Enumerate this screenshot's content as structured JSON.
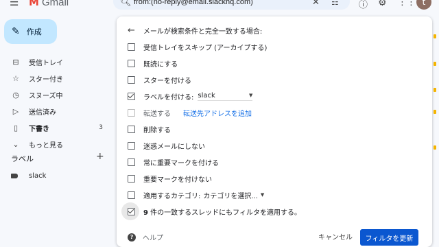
{
  "app": {
    "logo_text": "Gmail"
  },
  "search": {
    "query": "from:(no-reply@email.slackhq.com)"
  },
  "header": {
    "avatar_letter": "t"
  },
  "compose": {
    "label": "作成"
  },
  "nav": [
    {
      "icon": "inbox-icon",
      "label": "受信トレイ",
      "count": ""
    },
    {
      "icon": "star-icon",
      "label": "スター付き",
      "count": ""
    },
    {
      "icon": "clock-icon",
      "label": "スヌーズ中",
      "count": ""
    },
    {
      "icon": "send-icon",
      "label": "送信済み",
      "count": ""
    },
    {
      "icon": "draft-icon",
      "label": "下書き",
      "count": "3"
    },
    {
      "icon": "chevron-down-icon",
      "label": "もっと見る",
      "count": ""
    }
  ],
  "labels": {
    "heading": "ラベル",
    "items": [
      {
        "name": "slack"
      }
    ]
  },
  "filter": {
    "header": "メールが検索条件と完全一致する場合:",
    "options": [
      {
        "label": "受信トレイをスキップ (アーカイブする)"
      },
      {
        "label": "既読にする"
      },
      {
        "label": "スターを付ける"
      },
      {
        "label": "ラベルを付ける:",
        "value": "slack"
      },
      {
        "label": "転送する",
        "link": "転送先アドレスを追加"
      },
      {
        "label": "削除する"
      },
      {
        "label": "迷惑メールにしない"
      },
      {
        "label": "常に重要マークを付ける"
      },
      {
        "label": "重要マークを付けない"
      },
      {
        "label": "適用するカテゴリ:",
        "value": "カテゴリを選択..."
      },
      {
        "label_num": "9",
        "label_rest": " 件の一致するスレッドにもフィルタを適用する。"
      }
    ],
    "help": "ヘルプ",
    "cancel": "キャンセル",
    "update": "フィルタを更新"
  }
}
